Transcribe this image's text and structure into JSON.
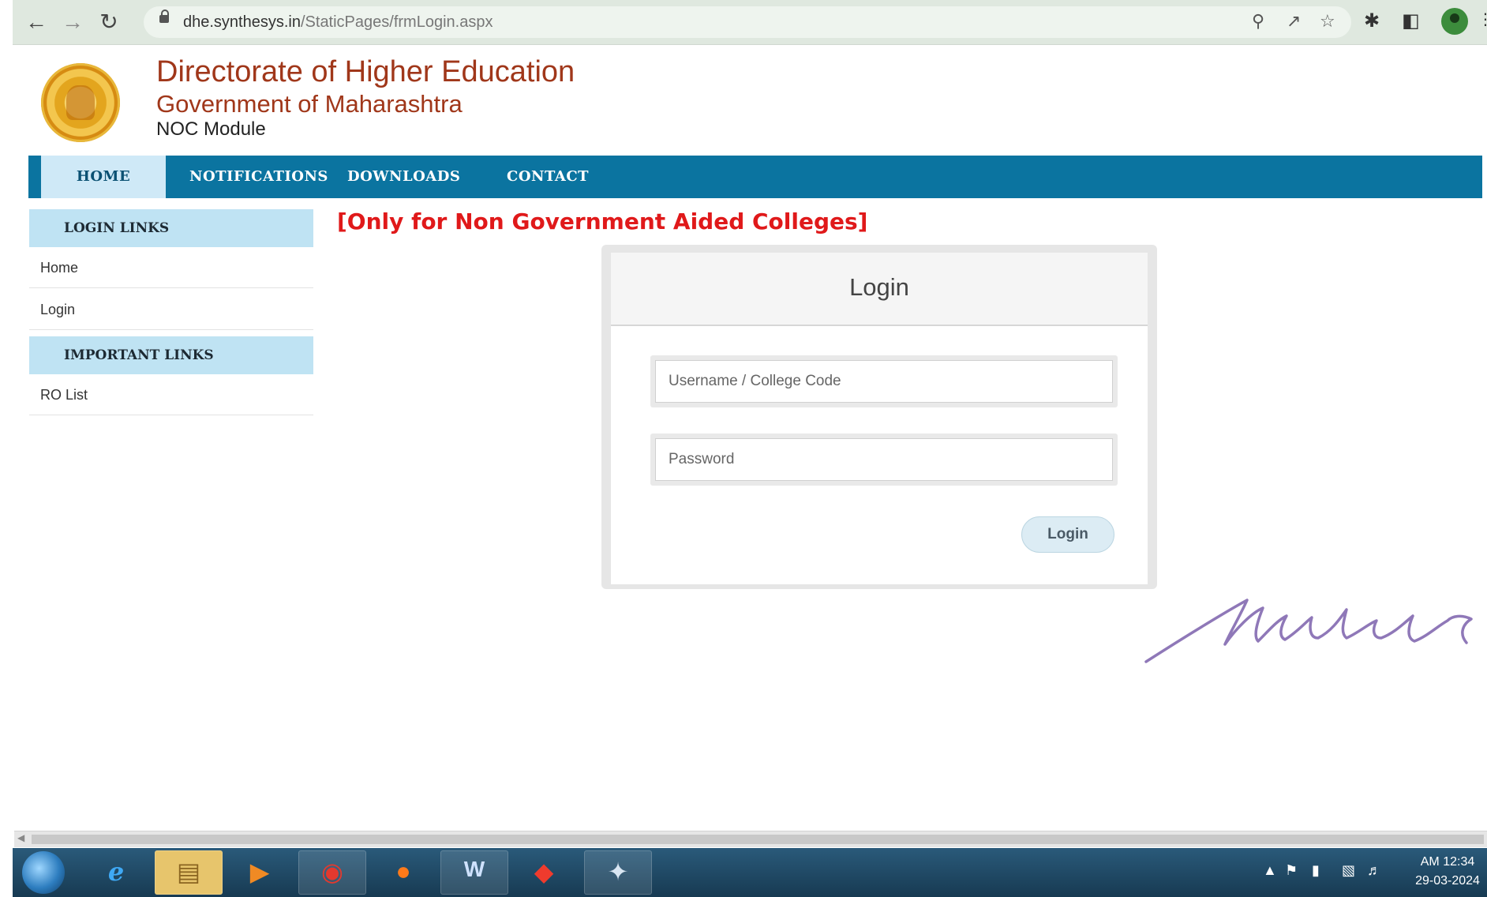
{
  "browser": {
    "url_host": "dhe.synthesys.in",
    "url_path": "/StaticPages/frmLogin.aspx"
  },
  "header": {
    "title": "Directorate of Higher Education",
    "subtitle": "Government of Maharashtra",
    "module": "NOC Module"
  },
  "nav": {
    "items": [
      {
        "label": "HOME",
        "active": true
      },
      {
        "label": "NOTIFICATIONS"
      },
      {
        "label": "DOWNLOADS"
      },
      {
        "label": "CONTACT"
      }
    ]
  },
  "sidebar": {
    "login_heading": "LOGIN LINKS",
    "login_links": [
      "Home",
      "Login"
    ],
    "important_heading": "IMPORTANT LINKS",
    "important_links": [
      "RO List"
    ]
  },
  "main": {
    "notice": "[Only for Non Government Aided Colleges]",
    "login_title": "Login",
    "username_placeholder": "Username / College Code",
    "password_placeholder": "Password",
    "login_button": "Login"
  },
  "taskbar": {
    "clock_time": "AM 12:34",
    "clock_date": "29-03-2024"
  },
  "colors": {
    "nav_bg": "#0b74a0",
    "sidebar_heading_bg": "#bfe3f3",
    "notice_red": "#e0191a",
    "title_brown": "#a0371a"
  }
}
